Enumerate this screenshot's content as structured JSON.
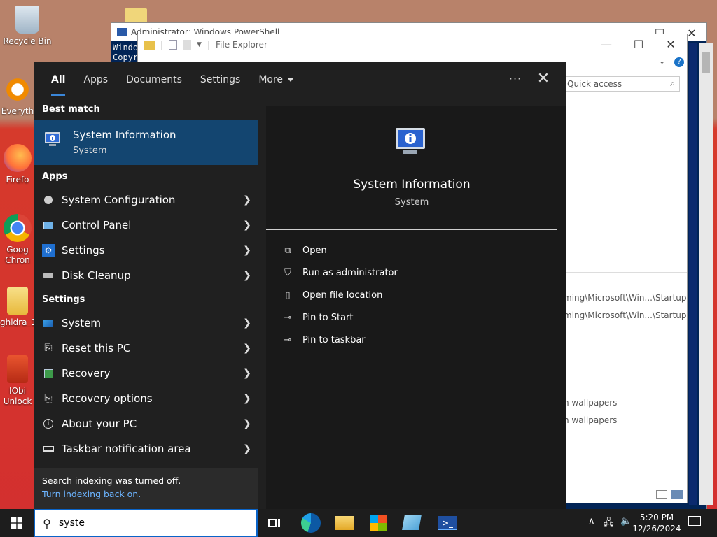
{
  "desktop": {
    "icons": [
      {
        "label": "Recycle Bin"
      },
      {
        "label": "Everyth"
      },
      {
        "label": "Firefo"
      },
      {
        "label": "Goog Chron"
      },
      {
        "label": "ghidra_1"
      },
      {
        "label": "IObi Unlock"
      }
    ]
  },
  "powershell": {
    "title": "Administrator: Windows PowerShell",
    "line1": "Windo",
    "line2": "Copyr"
  },
  "file_explorer": {
    "title": "File Explorer",
    "search_placeholder": "Quick access",
    "rows": [
      "ming\\Microsoft\\Win...\\Startup",
      "ming\\Microsoft\\Win...\\Startup",
      "n wallpapers",
      "n wallpapers"
    ]
  },
  "start_menu": {
    "tabs": [
      "All",
      "Apps",
      "Documents",
      "Settings",
      "More"
    ],
    "dots": "···",
    "close": "✕",
    "best_match_header": "Best match",
    "best_match": {
      "title": "System Information",
      "subtitle": "System"
    },
    "apps_header": "Apps",
    "apps": [
      {
        "label": "System Configuration"
      },
      {
        "label": "Control Panel"
      },
      {
        "label": "Settings"
      },
      {
        "label": "Disk Cleanup"
      }
    ],
    "settings_header": "Settings",
    "settings": [
      {
        "label": "System"
      },
      {
        "label": "Reset this PC"
      },
      {
        "label": "Recovery"
      },
      {
        "label": "Recovery options"
      },
      {
        "label": "About your PC"
      },
      {
        "label": "Taskbar notification area"
      }
    ],
    "index_notice": "Search indexing was turned off.",
    "index_link": "Turn indexing back on.",
    "detail": {
      "title": "System Information",
      "subtitle": "System",
      "actions": [
        {
          "label": "Open"
        },
        {
          "label": "Run as administrator"
        },
        {
          "label": "Open file location"
        },
        {
          "label": "Pin to Start"
        },
        {
          "label": "Pin to taskbar"
        }
      ]
    }
  },
  "taskbar": {
    "search_value": "syste",
    "time": "5:20 PM",
    "date": "12/26/2024"
  }
}
